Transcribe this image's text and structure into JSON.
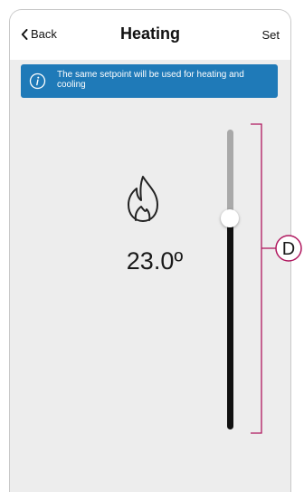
{
  "header": {
    "back_label": "Back",
    "title": "Heating",
    "set_label": "Set"
  },
  "banner": {
    "icon": "info-icon",
    "message": "The same setpoint will be used for heating and cooling"
  },
  "mode_icon": "flame-icon",
  "temperature": {
    "display": "23.0º",
    "slider_level": 0.3
  },
  "annotation": {
    "label": "D",
    "color": "#b0185f"
  },
  "colors": {
    "banner": "#1f7ab8",
    "screen_bg": "#ededed",
    "track_upper": "#a9a9a9",
    "track_lower": "#111111"
  }
}
